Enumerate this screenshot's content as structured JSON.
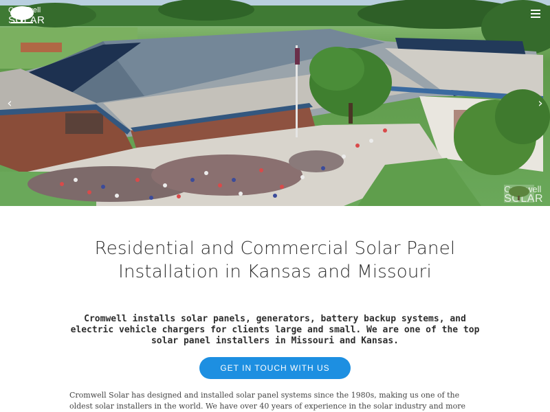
{
  "header": {
    "logo": {
      "line1": "Cromwell",
      "line2": "SOLAR"
    },
    "menu_icon": "hamburger-menu-icon"
  },
  "hero": {
    "prev_arrow": "‹",
    "next_arrow": "›",
    "watermark": {
      "line1": "Cromwell",
      "line2": "SOLAR"
    },
    "colors": {
      "sky": "#a9c7dd",
      "grass": "#5f9a4a",
      "roof": "#6f8294",
      "brick": "#8a4d39",
      "panel": "#1f3552"
    }
  },
  "main": {
    "headline": "Residential and Commercial Solar Panel Installation in Kansas and Missouri",
    "subhead": "Cromwell installs solar panels, generators, battery backup systems, and electric vehicle chargers for clients large and small. We are one of the top solar panel installers in Missouri and Kansas.",
    "cta_label": "GET IN TOUCH WITH US",
    "body": "Cromwell Solar has designed and installed solar panel systems since the 1980s, making us one of the oldest solar installers in the world. We have over 40 years of experience in the solar industry and more"
  },
  "colors": {
    "cta": "#1d8fe1",
    "headline": "#2f2f2f"
  }
}
